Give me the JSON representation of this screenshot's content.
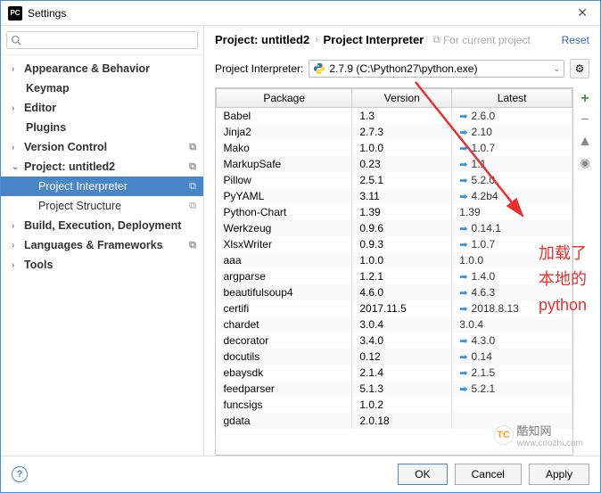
{
  "window": {
    "title": "Settings"
  },
  "search": {
    "placeholder": ""
  },
  "nav": {
    "appearance": "Appearance & Behavior",
    "keymap": "Keymap",
    "editor": "Editor",
    "plugins": "Plugins",
    "version_control": "Version Control",
    "project": "Project: untitled2",
    "project_interpreter": "Project Interpreter",
    "project_structure": "Project Structure",
    "build": "Build, Execution, Deployment",
    "languages": "Languages & Frameworks",
    "tools": "Tools"
  },
  "breadcrumb": {
    "p1": "Project: untitled2",
    "p2": "Project Interpreter",
    "for_project": "For current project",
    "reset": "Reset"
  },
  "interpreter": {
    "label": "Project Interpreter:",
    "selected": "2.7.9 (C:\\Python27\\python.exe)"
  },
  "table": {
    "headers": {
      "package": "Package",
      "version": "Version",
      "latest": "Latest"
    },
    "rows": [
      {
        "pkg": "Babel",
        "ver": "1.3",
        "latest": "2.6.0",
        "up": true
      },
      {
        "pkg": "Jinja2",
        "ver": "2.7.3",
        "latest": "2.10",
        "up": true
      },
      {
        "pkg": "Mako",
        "ver": "1.0.0",
        "latest": "1.0.7",
        "up": true
      },
      {
        "pkg": "MarkupSafe",
        "ver": "0.23",
        "latest": "1.1",
        "up": true
      },
      {
        "pkg": "Pillow",
        "ver": "2.5.1",
        "latest": "5.2.0",
        "up": true
      },
      {
        "pkg": "PyYAML",
        "ver": "3.11",
        "latest": "4.2b4",
        "up": true
      },
      {
        "pkg": "Python-Chart",
        "ver": "1.39",
        "latest": "1.39",
        "up": false
      },
      {
        "pkg": "Werkzeug",
        "ver": "0.9.6",
        "latest": "0.14.1",
        "up": true
      },
      {
        "pkg": "XlsxWriter",
        "ver": "0.9.3",
        "latest": "1.0.7",
        "up": true
      },
      {
        "pkg": "aaa",
        "ver": "1.0.0",
        "latest": "1.0.0",
        "up": false
      },
      {
        "pkg": "argparse",
        "ver": "1.2.1",
        "latest": "1.4.0",
        "up": true
      },
      {
        "pkg": "beautifulsoup4",
        "ver": "4.6.0",
        "latest": "4.6.3",
        "up": true
      },
      {
        "pkg": "certifi",
        "ver": "2017.11.5",
        "latest": "2018.8.13",
        "up": true
      },
      {
        "pkg": "chardet",
        "ver": "3.0.4",
        "latest": "3.0.4",
        "up": false
      },
      {
        "pkg": "decorator",
        "ver": "3.4.0",
        "latest": "4.3.0",
        "up": true
      },
      {
        "pkg": "docutils",
        "ver": "0.12",
        "latest": "0.14",
        "up": true
      },
      {
        "pkg": "ebaysdk",
        "ver": "2.1.4",
        "latest": "2.1.5",
        "up": true
      },
      {
        "pkg": "feedparser",
        "ver": "5.1.3",
        "latest": "5.2.1",
        "up": true
      },
      {
        "pkg": "funcsigs",
        "ver": "1.0.2",
        "latest": "",
        "up": false
      },
      {
        "pkg": "gdata",
        "ver": "2.0.18",
        "latest": "",
        "up": false
      }
    ]
  },
  "buttons": {
    "ok": "OK",
    "cancel": "Cancel",
    "apply": "Apply"
  },
  "annotation": {
    "line1": "加载了",
    "line2": "本地的",
    "line3": "python"
  },
  "watermark": {
    "name": "酷知网",
    "url": "www.coozhi.com"
  }
}
